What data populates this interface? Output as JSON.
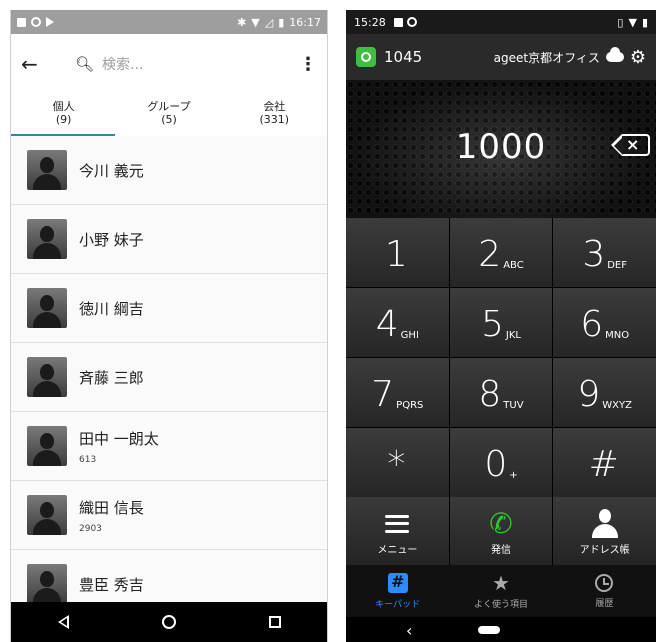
{
  "left": {
    "status": {
      "time": "16:17"
    },
    "search": {
      "placeholder": "検索..."
    },
    "tabs": [
      {
        "label": "個人",
        "count": "(9)"
      },
      {
        "label": "グループ",
        "count": "(5)"
      },
      {
        "label": "会社",
        "count": "(331)"
      }
    ],
    "contacts": [
      {
        "name": "今川 義元",
        "ext": ""
      },
      {
        "name": "小野 妹子",
        "ext": ""
      },
      {
        "name": "徳川 綱吉",
        "ext": ""
      },
      {
        "name": "斉藤 三郎",
        "ext": ""
      },
      {
        "name": "田中 一朗太",
        "ext": "613"
      },
      {
        "name": "織田 信長",
        "ext": "2903"
      },
      {
        "name": "豊臣 秀吉",
        "ext": ""
      }
    ]
  },
  "right": {
    "status": {
      "time": "15:28"
    },
    "header": {
      "extension": "1045",
      "account": "ageet京都オフィス"
    },
    "dialed_number": "1000",
    "keys": [
      {
        "digit": "1",
        "letters": ""
      },
      {
        "digit": "2",
        "letters": "ABC"
      },
      {
        "digit": "3",
        "letters": "DEF"
      },
      {
        "digit": "4",
        "letters": "GHI"
      },
      {
        "digit": "5",
        "letters": "JKL"
      },
      {
        "digit": "6",
        "letters": "MNO"
      },
      {
        "digit": "7",
        "letters": "PQRS"
      },
      {
        "digit": "8",
        "letters": "TUV"
      },
      {
        "digit": "9",
        "letters": "WXYZ"
      },
      {
        "digit": "*",
        "letters": ""
      },
      {
        "digit": "0",
        "letters": "+"
      },
      {
        "digit": "#",
        "letters": ""
      }
    ],
    "actions": {
      "menu": "メニュー",
      "call": "発信",
      "address_book": "アドレス帳"
    },
    "bottom_tabs": {
      "keypad": "キーパッド",
      "favorites": "よく使う項目",
      "history": "履歴"
    },
    "colors": {
      "call_green": "#2ec62e",
      "active_tab": "#2e8bff",
      "tab_underline": "#2a8f9b"
    }
  }
}
